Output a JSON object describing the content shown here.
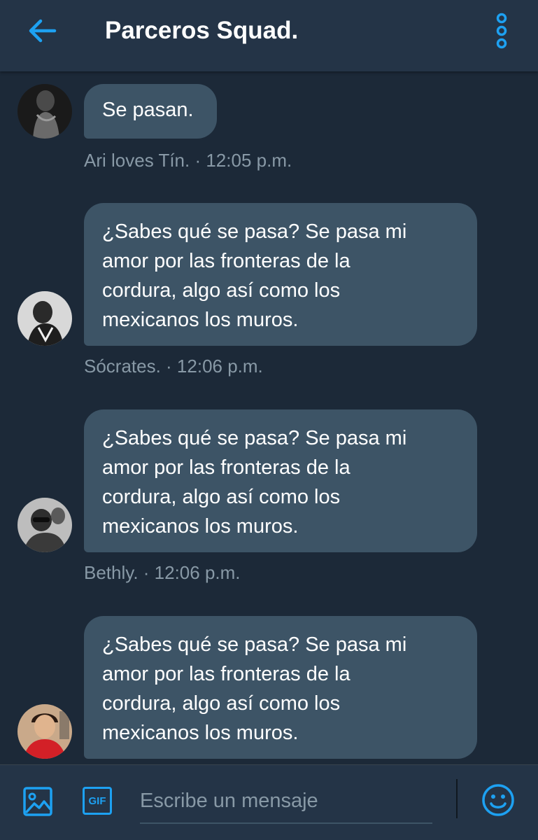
{
  "header": {
    "title": "Parceros Squad.",
    "back_icon": "arrow-left-icon",
    "more_icon": "more-vertical-icon"
  },
  "messages": [
    {
      "text": "Se pasan.",
      "sender": "Ari loves Tín.",
      "time": "12:05 p.m.",
      "meta": "Ari loves Tín. · 12:05 p.m."
    },
    {
      "text": "¿Sabes qué se pasa? Se pasa mi amor por las fronteras de la cordura, algo así como los mexicanos los muros.",
      "sender": "Sócrates.",
      "time": "12:06 p.m.",
      "meta": "Sócrates. · 12:06 p.m."
    },
    {
      "text": "¿Sabes qué se pasa? Se pasa mi amor por las fronteras de la cordura, algo así como los mexicanos los muros.",
      "sender": "Bethly.",
      "time": "12:06 p.m.",
      "meta": "Bethly. · 12:06 p.m."
    },
    {
      "text": "¿Sabes qué se pasa? Se pasa mi amor por las fronteras de la cordura, algo así como los mexicanos los muros.",
      "sender": "",
      "time": "",
      "meta": ""
    }
  ],
  "composer": {
    "placeholder": "Escribe un mensaje",
    "gif_label": "GIF",
    "image_icon": "image-icon",
    "emoji_icon": "emoji-icon"
  },
  "colors": {
    "accent": "#1da1f2",
    "header_bg": "#243447",
    "chat_bg": "#1c2938",
    "bubble_bg": "#3d5466",
    "meta_text": "#8899a6"
  }
}
